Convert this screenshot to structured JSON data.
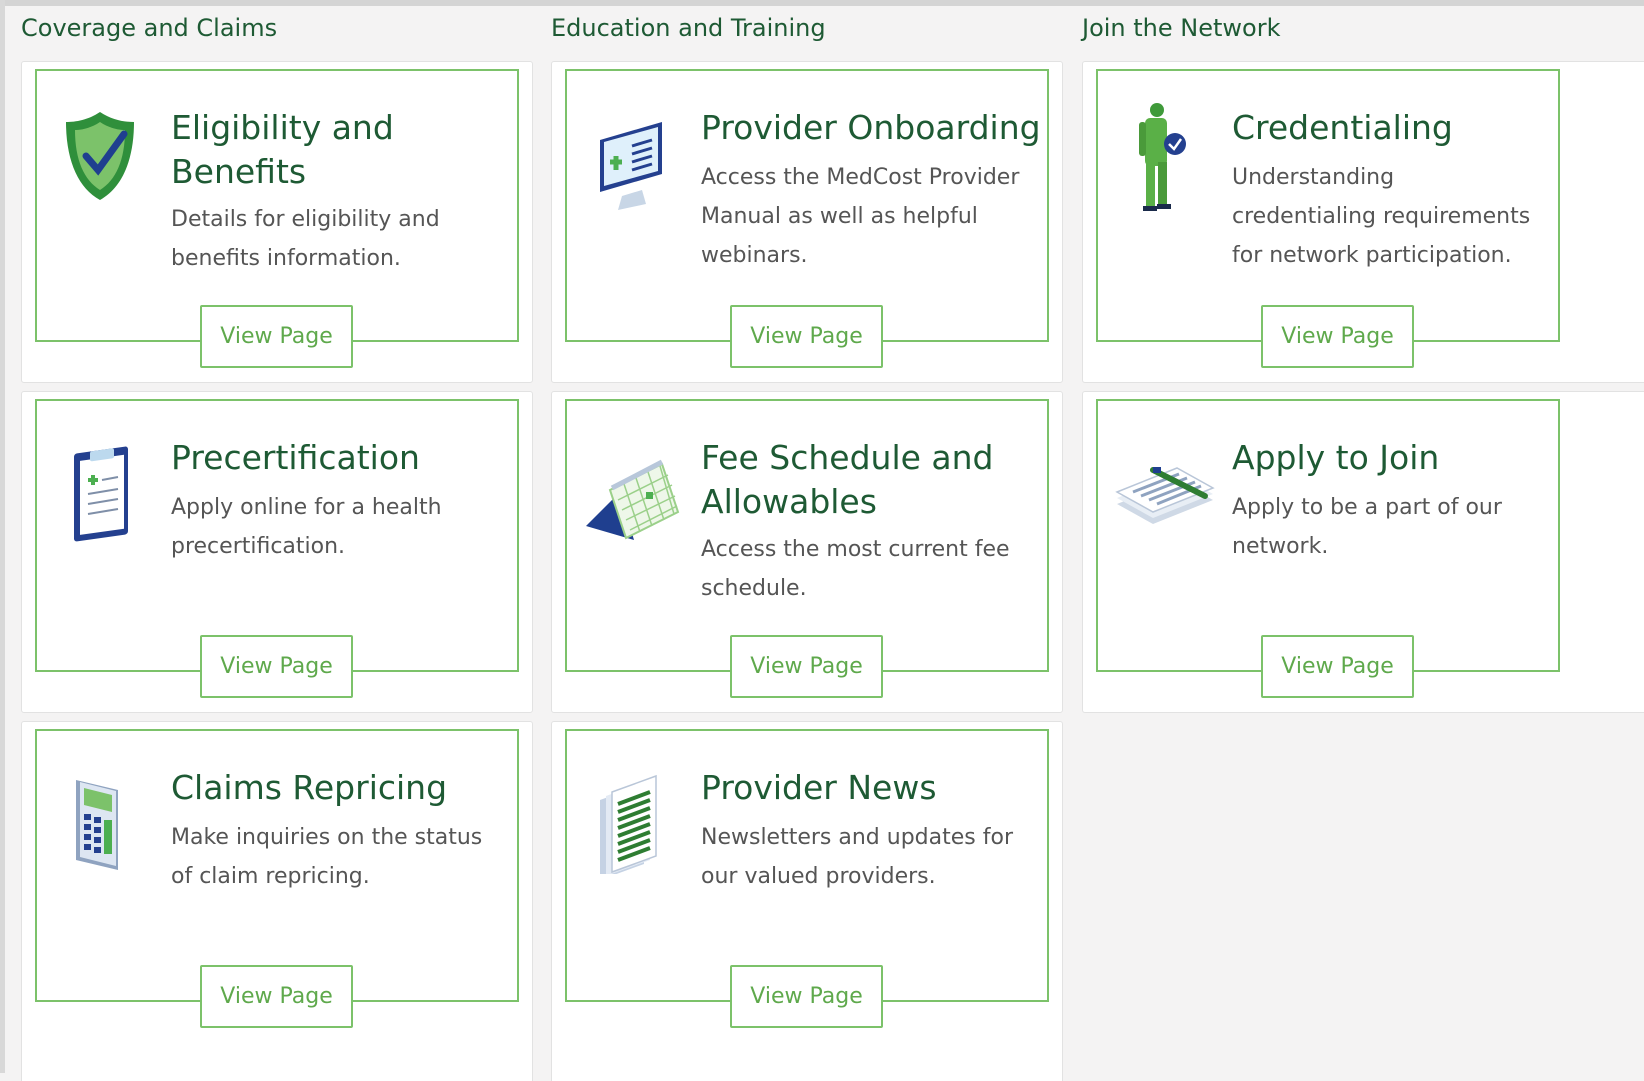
{
  "colors": {
    "accent": "#7cc26a",
    "heading": "#1e5a34",
    "text": "#555555",
    "button_text": "#5fa94c"
  },
  "sections": [
    {
      "title": "Coverage and Claims"
    },
    {
      "title": "Education and Training"
    },
    {
      "title": "Join the Network"
    }
  ],
  "cards": {
    "eligibility": {
      "icon": "shield-check-icon",
      "title": "Eligibility and Benefits",
      "description": "Details for eligibility and benefits information.",
      "button": "View Page"
    },
    "precert": {
      "icon": "clipboard-icon",
      "title": "Precertification",
      "description": "Apply online for a health precertification.",
      "button": "View Page"
    },
    "claims": {
      "icon": "calculator-icon",
      "title": "Claims Repricing",
      "description": "Make inquiries on the status of claim repricing.",
      "button": "View Page"
    },
    "onboarding": {
      "icon": "monitor-icon",
      "title": "Provider Onboarding",
      "description": "Access the MedCost Provider Manual as well as helpful webinars.",
      "button": "View Page"
    },
    "fee": {
      "icon": "calendar-icon",
      "title": "Fee Schedule and Allowables",
      "description": "Access the most current fee schedule.",
      "button": "View Page"
    },
    "news": {
      "icon": "newspaper-icon",
      "title": "Provider News",
      "description": "Newsletters and updates for our valued providers.",
      "button": "View Page"
    },
    "credentialing": {
      "icon": "doctor-icon",
      "title": "Credentialing",
      "description": "Understanding credentialing requirements for network participation.",
      "button": "View Page"
    },
    "apply": {
      "icon": "documents-pen-icon",
      "title": "Apply to Join",
      "description": "Apply to be a part of our network.",
      "button": "View Page"
    }
  }
}
